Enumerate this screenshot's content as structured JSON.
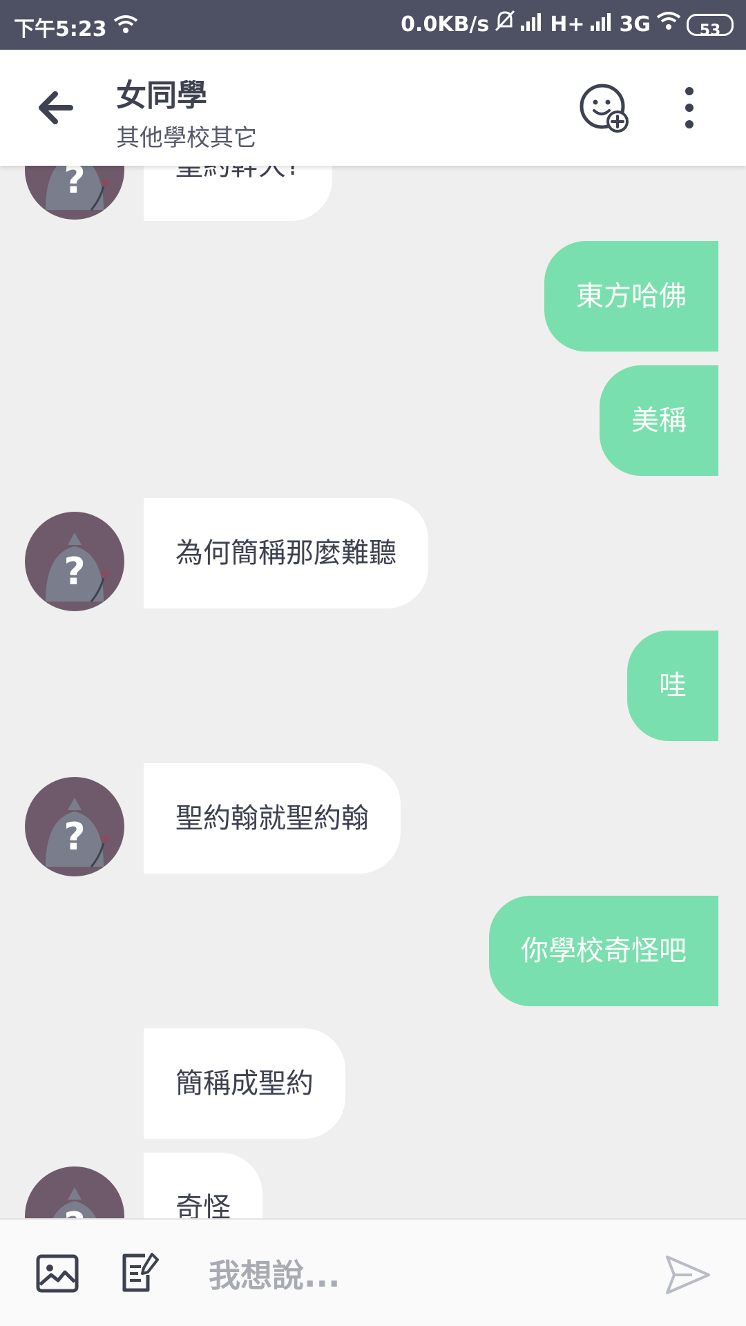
{
  "status_bar": {
    "time": "下午5:23",
    "network_speed": "0.0KB/s",
    "network_type_1": "H+",
    "network_type_2": "3G",
    "battery": "53"
  },
  "header": {
    "title": "女同學",
    "subtitle": "其他學校其它",
    "back_icon": "arrow-left-icon",
    "friend_icon": "face-plus-icon",
    "more_icon": "more-vertical-icon"
  },
  "messages": [
    {
      "side": "in",
      "text": "聖約幹大?",
      "avatar": true
    },
    {
      "side": "out",
      "text": "東方哈佛"
    },
    {
      "side": "out",
      "text": "美稱"
    },
    {
      "side": "in",
      "text": "為何簡稱那麼難聽",
      "avatar": true
    },
    {
      "side": "out",
      "text": "哇"
    },
    {
      "side": "in",
      "text": "聖約翰就聖約翰",
      "avatar": true
    },
    {
      "side": "out",
      "text": "你學校奇怪吧"
    },
    {
      "side": "in",
      "text": "簡稱成聖約",
      "avatar": false
    },
    {
      "side": "in",
      "text": "奇怪",
      "avatar": true
    }
  ],
  "input_bar": {
    "placeholder": "我想說...",
    "image_icon": "image-icon",
    "note_icon": "note-edit-icon",
    "send_icon": "send-icon"
  },
  "colors": {
    "status_bar": "#4d5163",
    "outgoing_bubble": "#7adfae",
    "incoming_bubble": "#ffffff",
    "chat_background": "#efefef",
    "avatar_bg": "#6e5a6a"
  }
}
